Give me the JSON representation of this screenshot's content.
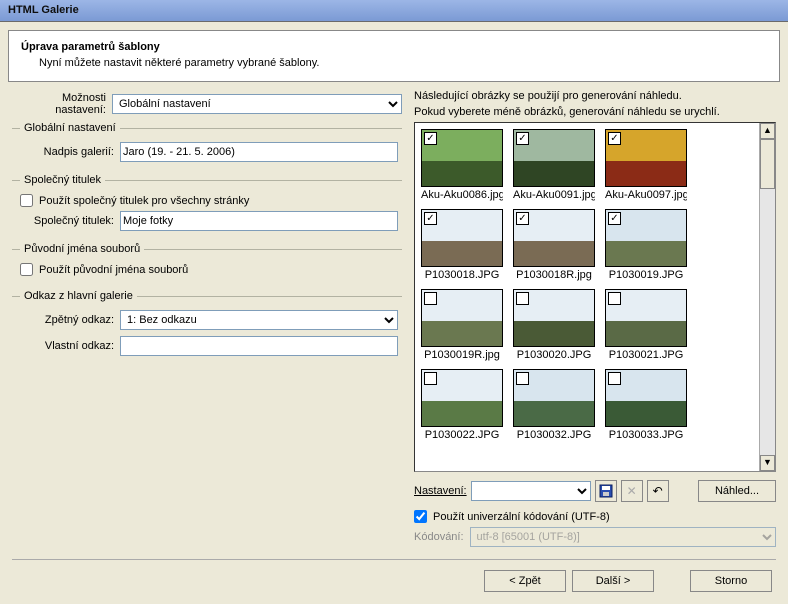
{
  "titlebar": "HTML Galerie",
  "header": {
    "title": "Úprava parametrů šablony",
    "desc": "Nyní můžete nastavit některé parametry vybrané šablony."
  },
  "left": {
    "options_label": "Možnosti nastavení:",
    "options_value": "Globální nastavení",
    "fs_global": "Globální nastavení",
    "gallery_title_label": "Nadpis galerií:",
    "gallery_title_value": "Jaro (19. - 21. 5. 2006)",
    "fs_common": "Společný titulek",
    "use_common_label": "Použít společný titulek pro všechny stránky",
    "common_title_label": "Společný titulek:",
    "common_title_value": "Moje fotky",
    "fs_orig": "Původní jména souborů",
    "use_orig_label": "Použít původní jména souborů",
    "fs_link": "Odkaz z hlavní galerie",
    "back_link_label": "Zpětný odkaz:",
    "back_link_value": "1: Bez odkazu",
    "custom_link_label": "Vlastní odkaz:",
    "custom_link_value": ""
  },
  "right": {
    "note1": "Následující obrázky se použijí pro generování náhledu.",
    "note2": "Pokud vyberete méně obrázků, generování náhledu se urychlí.",
    "thumbs": [
      {
        "name": "Aku-Aku0086.jpg",
        "checked": true,
        "sky": "#7cae5e",
        "ground": "#3c5a2a"
      },
      {
        "name": "Aku-Aku0091.jpg",
        "checked": true,
        "sky": "#9fb8a0",
        "ground": "#2f4524"
      },
      {
        "name": "Aku-Aku0097.jpg",
        "checked": true,
        "sky": "#d6a52b",
        "ground": "#8b2b16"
      },
      {
        "name": "P1030018.JPG",
        "checked": true,
        "sky": "#e6eef4",
        "ground": "#7a6b54"
      },
      {
        "name": "P1030018R.jpg",
        "checked": true,
        "sky": "#e6eef4",
        "ground": "#7a6b54"
      },
      {
        "name": "P1030019.JPG",
        "checked": true,
        "sky": "#d8e5ee",
        "ground": "#6a7850"
      },
      {
        "name": "P1030019R.jpg",
        "checked": false,
        "sky": "#e6eef4",
        "ground": "#6a7850"
      },
      {
        "name": "P1030020.JPG",
        "checked": false,
        "sky": "#e6eef4",
        "ground": "#4a5a36"
      },
      {
        "name": "P1030021.JPG",
        "checked": false,
        "sky": "#e6eef4",
        "ground": "#5a6a46"
      },
      {
        "name": "P1030022.JPG",
        "checked": false,
        "sky": "#e6eef4",
        "ground": "#5a7a46"
      },
      {
        "name": "P1030032.JPG",
        "checked": false,
        "sky": "#d8e5ee",
        "ground": "#4a6a46"
      },
      {
        "name": "P1030033.JPG",
        "checked": false,
        "sky": "#d8e5ee",
        "ground": "#3a5a36"
      }
    ],
    "settings_label": "Nastavení:",
    "settings_value": "",
    "preview_btn": "Náhled...",
    "use_utf8_label": "Použít univerzální kódování (UTF-8)",
    "encoding_label": "Kódování:",
    "encoding_value": "utf-8  [65001 (UTF-8)]"
  },
  "buttons": {
    "back": "< Zpět",
    "next": "Další >",
    "cancel": "Storno"
  }
}
